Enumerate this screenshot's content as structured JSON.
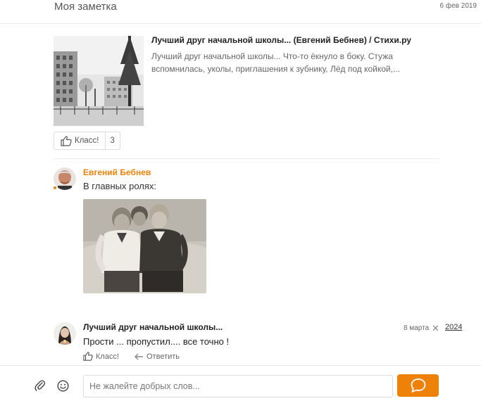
{
  "header": {
    "title": "Моя заметка",
    "date": "6 фев 2019"
  },
  "link_card": {
    "title": "Лучший друг начальной школы... (Евгений Бебнев) / Стихи.ру",
    "description": "Лучший друг начальной школы... Что-то ёкнуло в боку. Стужа вспомнилась, уколы, приглашения к зубнику, Лёд под койкой,..."
  },
  "klass": {
    "label": "Класс!",
    "count": "3"
  },
  "comments": [
    {
      "author": "Евгений Бебнев",
      "text": "В главных ролях:"
    },
    {
      "author": "Лучший друг начальной школы...",
      "text": "Прости ... пропустил.... все точно !",
      "date": "8 марта",
      "close": "✕",
      "year": "2024",
      "actions": {
        "like_label": "Класс!",
        "reply_label": "Ответить"
      }
    }
  ],
  "footer": {
    "placeholder": "Не жалейте добрых слов..."
  },
  "colors": {
    "accent": "#ee8208",
    "text": "#333333",
    "muted": "#666666"
  },
  "icons": [
    "thumbs-up-icon",
    "reply-arrow-icon",
    "close-icon",
    "paperclip-icon",
    "smile-icon",
    "chat-bubble-icon"
  ]
}
